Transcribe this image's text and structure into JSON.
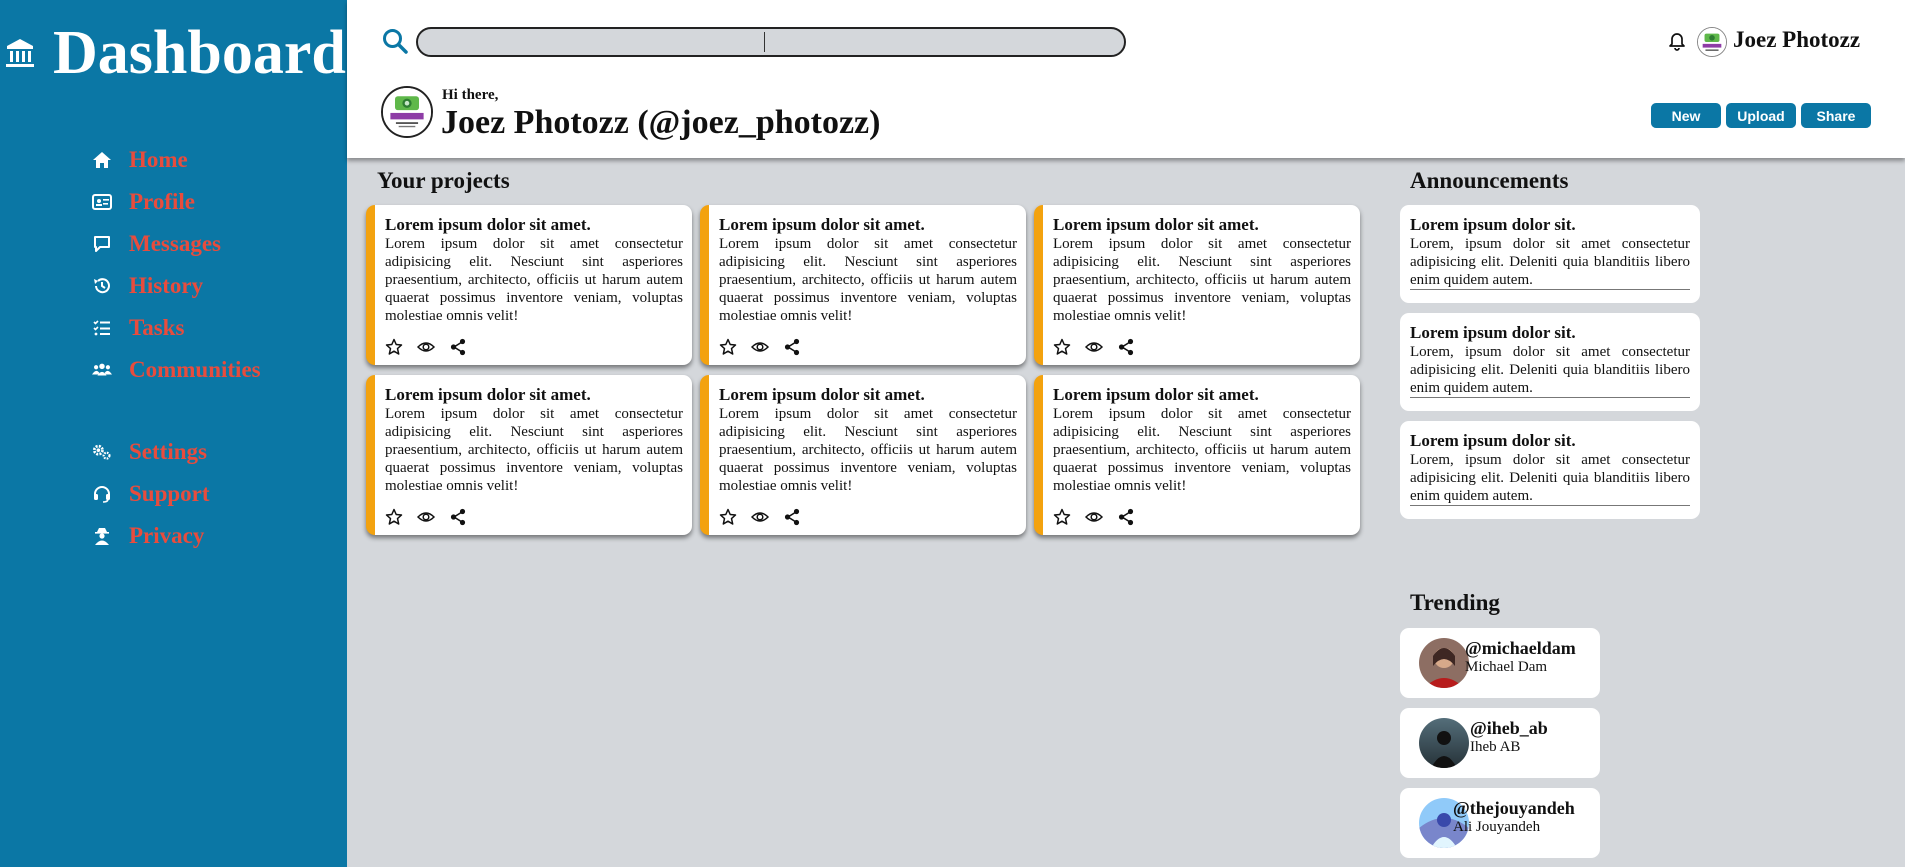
{
  "sidebar": {
    "title": "Dashboard",
    "items": [
      {
        "label": "Home",
        "icon": "home-icon"
      },
      {
        "label": "Profile",
        "icon": "id-card-icon"
      },
      {
        "label": "Messages",
        "icon": "message-icon"
      },
      {
        "label": "History",
        "icon": "history-icon"
      },
      {
        "label": "Tasks",
        "icon": "tasks-icon"
      },
      {
        "label": "Communities",
        "icon": "users-icon"
      },
      {
        "label": "Settings",
        "icon": "gears-icon"
      },
      {
        "label": "Support",
        "icon": "headset-icon"
      },
      {
        "label": "Privacy",
        "icon": "user-secret-icon"
      }
    ]
  },
  "header": {
    "search_value": "",
    "username": "Joez Photozz",
    "greeting": "Hi there,",
    "profile_name": "Joez Photozz (@joez_photozz)",
    "buttons": {
      "new": "New",
      "upload": "Upload",
      "share": "Share"
    }
  },
  "projects": {
    "title": "Your projects",
    "cards": [
      {
        "title": "Lorem ipsum dolor sit amet.",
        "text": "Lorem ipsum dolor sit amet consectetur adipisicing elit. Nesciunt sint asperiores praesentium, architecto, officiis ut harum autem quaerat possimus inventore veniam, voluptas molestiae omnis velit!"
      },
      {
        "title": "Lorem ipsum dolor sit amet.",
        "text": "Lorem ipsum dolor sit amet consectetur adipisicing elit. Nesciunt sint asperiores praesentium, architecto, officiis ut harum autem quaerat possimus inventore veniam, voluptas molestiae omnis velit!"
      },
      {
        "title": "Lorem ipsum dolor sit amet.",
        "text": "Lorem ipsum dolor sit amet consectetur adipisicing elit. Nesciunt sint asperiores praesentium, architecto, officiis ut harum autem quaerat possimus inventore veniam, voluptas molestiae omnis velit!"
      },
      {
        "title": "Lorem ipsum dolor sit amet.",
        "text": "Lorem ipsum dolor sit amet consectetur adipisicing elit. Nesciunt sint asperiores praesentium, architecto, officiis ut harum autem quaerat possimus inventore veniam, voluptas molestiae omnis velit!"
      },
      {
        "title": "Lorem ipsum dolor sit amet.",
        "text": "Lorem ipsum dolor sit amet consectetur adipisicing elit. Nesciunt sint asperiores praesentium, architecto, officiis ut harum autem quaerat possimus inventore veniam, voluptas molestiae omnis velit!"
      },
      {
        "title": "Lorem ipsum dolor sit amet.",
        "text": "Lorem ipsum dolor sit amet consectetur adipisicing elit. Nesciunt sint asperiores praesentium, architecto, officiis ut harum autem quaerat possimus inventore veniam, voluptas molestiae omnis velit!"
      }
    ]
  },
  "announcements": {
    "title": "Announcements",
    "items": [
      {
        "title": "Lorem ipsum dolor sit.",
        "text": "Lorem, ipsum dolor sit amet consectetur adipisicing elit. Deleniti quia blanditiis libero enim quidem autem."
      },
      {
        "title": "Lorem ipsum dolor sit.",
        "text": "Lorem, ipsum dolor sit amet consectetur adipisicing elit. Deleniti quia blanditiis libero enim quidem autem."
      },
      {
        "title": "Lorem ipsum dolor sit.",
        "text": "Lorem, ipsum dolor sit amet consectetur adipisicing elit. Deleniti quia blanditiis libero enim quidem autem."
      }
    ]
  },
  "trending": {
    "title": "Trending",
    "items": [
      {
        "handle": "@michaeldam",
        "name": "Michael Dam"
      },
      {
        "handle": "@iheb_ab",
        "name": "Iheb AB"
      },
      {
        "handle": "@thejouyandeh",
        "name": "Ali Jouyandeh"
      }
    ]
  },
  "colors": {
    "sidebar": "#0b77a5",
    "nav_label": "#e84c3d",
    "card_accent": "#f3a20f",
    "background": "#d4d7db"
  }
}
